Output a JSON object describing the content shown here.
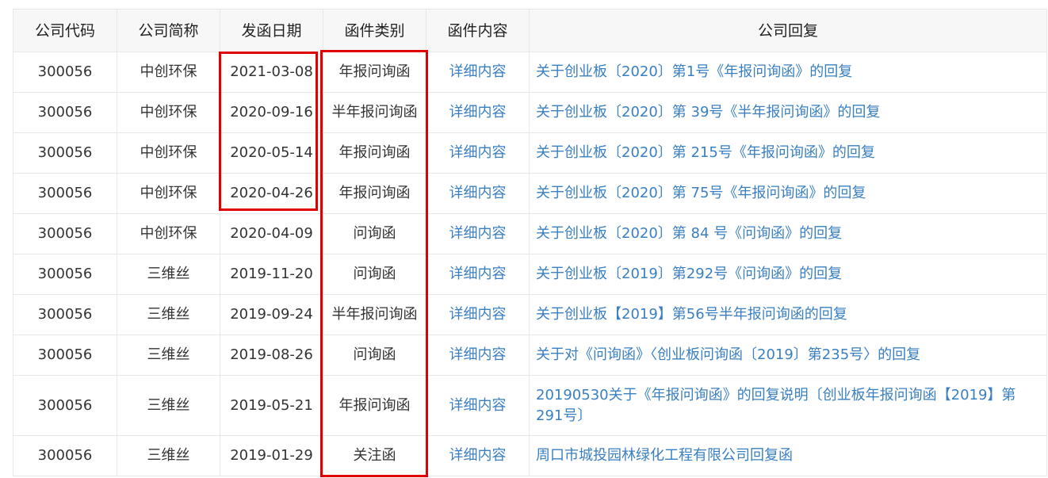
{
  "table": {
    "headers": [
      "公司代码",
      "公司简称",
      "发函日期",
      "函件类别",
      "函件内容",
      "公司回复"
    ],
    "rows": [
      {
        "code": "300056",
        "name": "中创环保",
        "date": "2021-03-08",
        "type": "年报问询函",
        "content": "详细内容",
        "reply": "关于创业板〔2020〕第1号《年报问询函》的回复"
      },
      {
        "code": "300056",
        "name": "中创环保",
        "date": "2020-09-16",
        "type": "半年报问询函",
        "content": "详细内容",
        "reply": "关于创业板〔2020〕第 39号《半年报问询函》的回复"
      },
      {
        "code": "300056",
        "name": "中创环保",
        "date": "2020-05-14",
        "type": "年报问询函",
        "content": "详细内容",
        "reply": "关于创业板〔2020〕第 215号《年报问询函》的回复"
      },
      {
        "code": "300056",
        "name": "中创环保",
        "date": "2020-04-26",
        "type": "年报问询函",
        "content": "详细内容",
        "reply": "关于创业板〔2020〕第 75号《年报问询函》的回复"
      },
      {
        "code": "300056",
        "name": "中创环保",
        "date": "2020-04-09",
        "type": "问询函",
        "content": "详细内容",
        "reply": "关于创业板〔2020〕第 84 号《问询函》的回复"
      },
      {
        "code": "300056",
        "name": "三维丝",
        "date": "2019-11-20",
        "type": "问询函",
        "content": "详细内容",
        "reply": "关于创业板〔2019〕第292号《问询函》的回复"
      },
      {
        "code": "300056",
        "name": "三维丝",
        "date": "2019-09-24",
        "type": "半年报问询函",
        "content": "详细内容",
        "reply": "关于创业板【2019】第56号半年报问询函的回复"
      },
      {
        "code": "300056",
        "name": "三维丝",
        "date": "2019-08-26",
        "type": "问询函",
        "content": "详细内容",
        "reply": "关于对《问询函》〈创业板问询函〔2019〕第235号〉的回复"
      },
      {
        "code": "300056",
        "name": "三维丝",
        "date": "2019-05-21",
        "type": "年报问询函",
        "content": "详细内容",
        "reply": "20190530关于《年报问询函》的回复说明〔创业板年报问询函【2019】第291号〕"
      },
      {
        "code": "300056",
        "name": "三维丝",
        "date": "2019-01-29",
        "type": "关注函",
        "content": "详细内容",
        "reply": "周口市城投园林绿化工程有限公司回复函"
      }
    ]
  },
  "highlight_color": "#e00000",
  "link_color": "#3a7fc1"
}
